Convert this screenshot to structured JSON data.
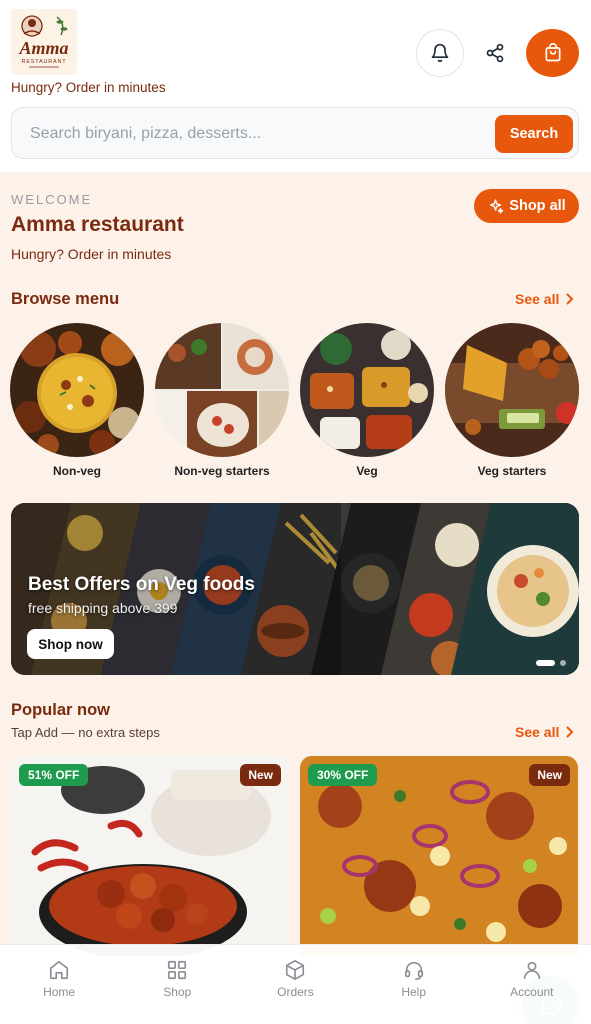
{
  "header": {
    "logo_text": "Amma",
    "logo_subtext": "RESTAURANT",
    "tagline": "Hungry? Order in minutes",
    "icons": {
      "notifications": "bell-icon",
      "share": "share-icon",
      "cart": "shopping-bag-icon"
    }
  },
  "search": {
    "placeholder": "Search biryani, pizza, desserts...",
    "button_label": "Search"
  },
  "welcome": {
    "label": "WELCOME",
    "restaurant_name": "Amma restaurant",
    "subtitle": "Hungry? Order in minutes",
    "shop_all_label": "Shop all"
  },
  "browse": {
    "title": "Browse menu",
    "see_all": "See all",
    "categories": [
      {
        "label": "Non-veg"
      },
      {
        "label": "Non-veg starters"
      },
      {
        "label": "Veg"
      },
      {
        "label": "Veg starters"
      }
    ]
  },
  "banner": {
    "title": "Best Offers on Veg foods",
    "subtitle": "free shipping above 399",
    "button_label": "Shop now",
    "slide_count": 2,
    "active_slide": 1
  },
  "popular": {
    "title": "Popular now",
    "subtitle": "Tap Add — no extra steps",
    "see_all": "See all",
    "items": [
      {
        "discount": "51% OFF",
        "tag": "New"
      },
      {
        "discount": "30% OFF",
        "tag": "New"
      }
    ]
  },
  "bottom_nav": [
    {
      "label": "Home",
      "icon": "home-icon"
    },
    {
      "label": "Shop",
      "icon": "grid-icon"
    },
    {
      "label": "Orders",
      "icon": "box-icon"
    },
    {
      "label": "Help",
      "icon": "headset-icon"
    },
    {
      "label": "Account",
      "icon": "user-icon"
    }
  ],
  "colors": {
    "accent": "#e8580c",
    "brand_text": "#7a2a0e",
    "page_bg": "#fdf2e9",
    "discount_badge": "#1e9b4d",
    "new_badge": "#7a2a0e",
    "chat_fab": "#1ec46a"
  }
}
